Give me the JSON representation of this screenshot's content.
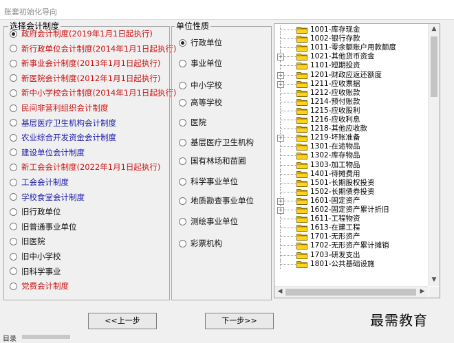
{
  "window": {
    "title": "账套初始化导向"
  },
  "system_group": {
    "legend": "选择会计制度",
    "options": [
      {
        "label": "政府会计制度(2019年1月1日起执行)",
        "color": "red",
        "selected": true
      },
      {
        "label": "新行政单位会计制度(2014年1月1日起执行)",
        "color": "red",
        "selected": false
      },
      {
        "label": "新事业会计制度(2013年1月1日起执行)",
        "color": "red",
        "selected": false
      },
      {
        "label": "新医院会计制度(2012年1月1日起执行)",
        "color": "red",
        "selected": false
      },
      {
        "label": "新中小学校会计制度(2014年1月1日起执行)",
        "color": "red",
        "selected": false
      },
      {
        "label": "民间非营利组织会计制度",
        "color": "red",
        "selected": false
      },
      {
        "label": "基层医疗卫生机构会计制度",
        "color": "blue",
        "selected": false
      },
      {
        "label": "农业综合开发资金会计制度",
        "color": "blue",
        "selected": false
      },
      {
        "label": "建设单位会计制度",
        "color": "blue",
        "selected": false
      },
      {
        "label": "新工会会计制度(2022年1月1日起执行)",
        "color": "red",
        "selected": false
      },
      {
        "label": "工会会计制度",
        "color": "blue",
        "selected": false
      },
      {
        "label": "学校食堂会计制度",
        "color": "blue",
        "selected": false
      },
      {
        "label": "旧行政单位",
        "color": "black",
        "selected": false
      },
      {
        "label": "旧普通事业单位",
        "color": "black",
        "selected": false
      },
      {
        "label": "旧医院",
        "color": "black",
        "selected": false
      },
      {
        "label": "旧中小学校",
        "color": "black",
        "selected": false
      },
      {
        "label": "旧科学事业",
        "color": "black",
        "selected": false
      },
      {
        "label": "党费会计制度",
        "color": "red",
        "selected": false
      }
    ]
  },
  "unit_group": {
    "legend": "单位性质",
    "options": [
      {
        "label": "行政单位",
        "selected": true
      },
      {
        "label": "事业单位",
        "selected": false
      },
      {
        "label": "中小学校",
        "selected": false
      },
      {
        "label": "高等学校",
        "selected": false
      },
      {
        "label": "医院",
        "selected": false
      },
      {
        "label": "基层医疗卫生机构",
        "selected": false
      },
      {
        "label": "国有林场和苗圃",
        "selected": false
      },
      {
        "label": "科学事业单位",
        "selected": false
      },
      {
        "label": "地质勘查事业单位",
        "selected": false
      },
      {
        "label": "测绘事业单位",
        "selected": false
      },
      {
        "label": "彩票机构",
        "selected": false
      }
    ]
  },
  "account_tree": {
    "items": [
      {
        "label": "1001-库存现金",
        "expandable": false
      },
      {
        "label": "1002-银行存款",
        "expandable": false
      },
      {
        "label": "1011-零余额账户用款额度",
        "expandable": false
      },
      {
        "label": "1021-其他货币资金",
        "expandable": true
      },
      {
        "label": "1101-短期投资",
        "expandable": false
      },
      {
        "label": "1201-财政应返还额度",
        "expandable": true
      },
      {
        "label": "1211-应收票据",
        "expandable": true
      },
      {
        "label": "1212-应收账款",
        "expandable": false
      },
      {
        "label": "1214-预付账款",
        "expandable": false
      },
      {
        "label": "1215-应收股利",
        "expandable": false
      },
      {
        "label": "1216-应收利息",
        "expandable": false
      },
      {
        "label": "1218-其他应收款",
        "expandable": false
      },
      {
        "label": "1219-坏账准备",
        "expandable": true
      },
      {
        "label": "1301-在途物品",
        "expandable": false
      },
      {
        "label": "1302-库存物品",
        "expandable": false
      },
      {
        "label": "1303-加工物品",
        "expandable": false
      },
      {
        "label": "1401-待摊费用",
        "expandable": false
      },
      {
        "label": "1501-长期股权投资",
        "expandable": false
      },
      {
        "label": "1502-长期债券投资",
        "expandable": false
      },
      {
        "label": "1601-固定资产",
        "expandable": true
      },
      {
        "label": "1602-固定资产累计折旧",
        "expandable": true
      },
      {
        "label": "1611-工程物资",
        "expandable": false
      },
      {
        "label": "1613-在建工程",
        "expandable": false
      },
      {
        "label": "1701-无形资产",
        "expandable": false
      },
      {
        "label": "1702-无形资产累计摊销",
        "expandable": false
      },
      {
        "label": "1703-研发支出",
        "expandable": false
      },
      {
        "label": "1801-公共基础设施",
        "expandable": false
      }
    ],
    "scroll_up_icon": "triangle-up-icon",
    "scroll_down_icon": "triangle-down-icon"
  },
  "buttons": {
    "prev": "<<上一步",
    "next": "下一步>>"
  },
  "watermark": "最需教育",
  "bottom": {
    "label": "目录"
  },
  "colors": {
    "red": "#d01010",
    "blue": "#1a1ab0",
    "folder": "#f5c400"
  }
}
